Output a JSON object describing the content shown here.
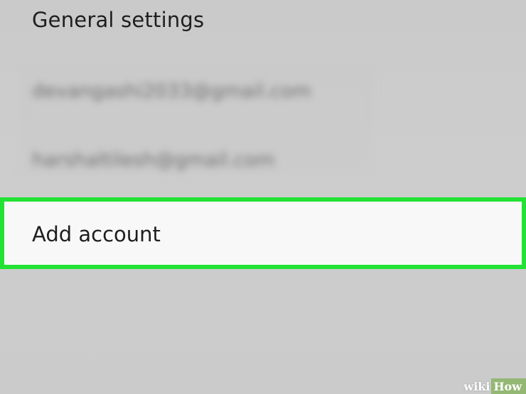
{
  "settings": {
    "general_settings_label": "General settings",
    "accounts": [
      {
        "email": "devangashi2033@gmail.com"
      },
      {
        "email": "harshaltilesh@gmail.com"
      }
    ],
    "add_account_label": "Add account",
    "highlight_color": "#22e234"
  },
  "watermark": {
    "wiki": "wiki",
    "how": "How"
  }
}
